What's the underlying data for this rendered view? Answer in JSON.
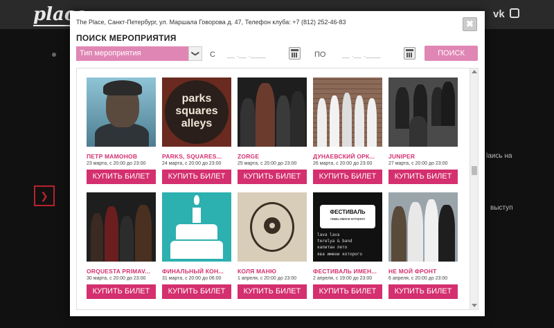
{
  "background": {
    "logo": "place",
    "social_vk": "vk",
    "snippet_1": "lаись на",
    "snippet_2": "выступ"
  },
  "modal": {
    "address": "The Place, Санкт-Петербург, ул. Маршала Говорова д. 47, Телефон клуба: +7 (812) 252-46-83",
    "close_label": "✖",
    "search_title": "ПОИСК МЕРОПРИЯТИЯ",
    "type_select": {
      "value": "Тип мероприятия",
      "arrow": "❯"
    },
    "from_label": "С",
    "to_label": "ПО",
    "date_from": "__ .__ .____",
    "date_to": "__ .__ .____",
    "search_button": "ПОИСК"
  },
  "events": [
    {
      "title": "ПЕТР МАМОНОВ",
      "date": "23 марта, с 20:00 до 23:00",
      "button": "КУПИТЬ БИЛЕТ"
    },
    {
      "title": "PARKS, SQUARES...",
      "date": "24 марта, с 20:00 до 23:00",
      "button": "КУПИТЬ БИЛЕТ",
      "art_lines": [
        "parks",
        "squares",
        "alleys"
      ]
    },
    {
      "title": "ZORGE",
      "date": "25 марта, с 20:00 до 23:00",
      "button": "КУПИТЬ БИЛЕТ"
    },
    {
      "title": "ДУНАЕВСКИЙ ОРК...",
      "date": "26 марта, с 20:00 до 23:00",
      "button": "КУПИТЬ БИЛЕТ"
    },
    {
      "title": "JUNIPER",
      "date": "27 марта, с 20:00 до 23:00",
      "button": "КУПИТЬ БИЛЕТ"
    },
    {
      "title": "ORQUESTA PRIMAV...",
      "date": "30 марта, с 20:00 до 23:00",
      "button": "КУПИТЬ БИЛЕТ"
    },
    {
      "title": "ФИНАЛЬНЫЙ КОН...",
      "date": "31 марта, с 20:00 до 06:00",
      "button": "КУПИТЬ БИЛЕТ"
    },
    {
      "title": "КОЛЯ МАНЮ",
      "date": "1 апреля, с 20:00 до 23:00",
      "button": "КУПИТЬ БИЛЕТ"
    },
    {
      "title": "ФЕСТИВАЛЬ ИМЕН...",
      "date": "2 апреля, с 19:00 до 23:00",
      "button": "КУПИТЬ БИЛЕТ",
      "art_lines": [
        "ФЕСТИВАЛЬ",
        "ламы имени которого",
        "lava lava",
        "terelya & band",
        "капитан лето",
        "ява имени которого"
      ]
    },
    {
      "title": "НЕ МОЙ ФРОНТ",
      "date": "6 апреля, с 20:00 до 23:00",
      "button": "КУПИТЬ БИЛЕТ"
    }
  ]
}
